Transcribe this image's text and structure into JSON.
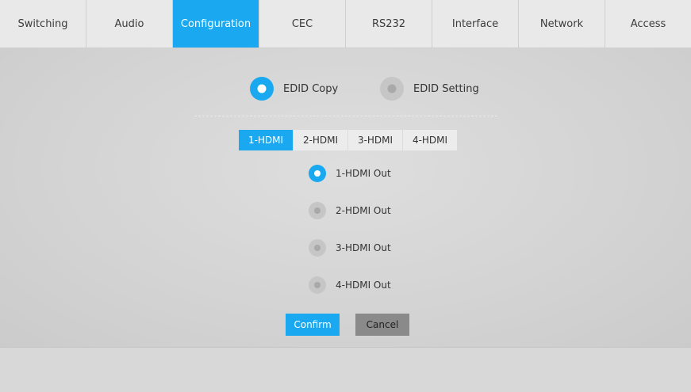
{
  "nav": {
    "tabs": [
      {
        "label": "Switching"
      },
      {
        "label": "Audio"
      },
      {
        "label": "Configuration"
      },
      {
        "label": "CEC"
      },
      {
        "label": "RS232"
      },
      {
        "label": "Interface"
      },
      {
        "label": "Network"
      },
      {
        "label": "Access"
      }
    ],
    "active_index": 2
  },
  "mode": {
    "options": [
      {
        "label": "EDID Copy",
        "selected": true
      },
      {
        "label": "EDID Setting",
        "selected": false
      }
    ]
  },
  "source_tabs": {
    "items": [
      {
        "label": "1-HDMI"
      },
      {
        "label": "2-HDMI"
      },
      {
        "label": "3-HDMI"
      },
      {
        "label": "4-HDMI"
      }
    ],
    "active_index": 0
  },
  "outputs": {
    "items": [
      {
        "label": "1-HDMI Out",
        "selected": true
      },
      {
        "label": "2-HDMI Out",
        "selected": false
      },
      {
        "label": "3-HDMI Out",
        "selected": false
      },
      {
        "label": "4-HDMI Out",
        "selected": false
      }
    ]
  },
  "actions": {
    "confirm_label": "Confirm",
    "cancel_label": "Cancel"
  },
  "colors": {
    "accent": "#1aa9f0",
    "cancel": "#8a8a8a"
  }
}
